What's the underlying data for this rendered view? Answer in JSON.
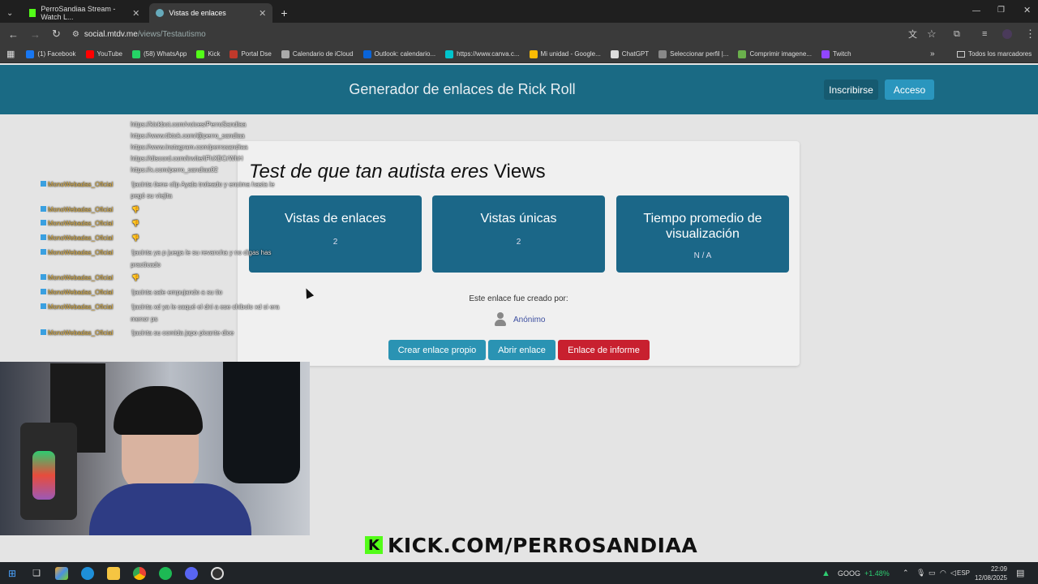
{
  "browser": {
    "tabs": [
      {
        "label": "PerroSandiaa Stream - Watch L..."
      },
      {
        "label": "Vistas de enlaces"
      }
    ],
    "url_host": "social.mtdv.me",
    "url_path": "/views/Testautismo",
    "bookmarks": [
      {
        "label": "(1) Facebook",
        "color": "#1877f2"
      },
      {
        "label": "YouTube",
        "color": "#ff0000"
      },
      {
        "label": "(58) WhatsApp",
        "color": "#25d366"
      },
      {
        "label": "Kick",
        "color": "#53fc18"
      },
      {
        "label": "Portal Dse",
        "color": "#c0392b"
      },
      {
        "label": "Calendario de iCloud",
        "color": "#aaaaaa"
      },
      {
        "label": "Outlook: calendario...",
        "color": "#0a64d8"
      },
      {
        "label": "https://www.canva.c...",
        "color": "#00c4cc"
      },
      {
        "label": "Mi unidad - Google...",
        "color": "#fbbc04"
      },
      {
        "label": "ChatGPT",
        "color": "#dddddd"
      },
      {
        "label": "Seleccionar perfil |...",
        "color": "#888888"
      },
      {
        "label": "Comprimir imagene...",
        "color": "#6ab04c"
      },
      {
        "label": "Twitch",
        "color": "#9146ff"
      }
    ],
    "all_bookmarks": "Todos los marcadores"
  },
  "site": {
    "title": "Generador de enlaces de Rick Roll",
    "signup": "Inscribirse",
    "login": "Acceso"
  },
  "card": {
    "title_italic": "Test de que tan autista eres",
    "title_suffix": " Views",
    "stats": [
      {
        "label": "Vistas de enlaces",
        "value": "2"
      },
      {
        "label": "Vistas únicas",
        "value": "2"
      },
      {
        "label": "Tiempo promedio de visualización",
        "value": "N / A"
      }
    ],
    "creator_label": "Este enlace fue creado por:",
    "creator_name": "Anónimo",
    "buttons": {
      "create": "Crear enlace propio",
      "open": "Abrir enlace",
      "report": "Enlace de informe"
    }
  },
  "chat": [
    {
      "user": "",
      "text": "https://kickbot.com/voices/PerroSandiaa"
    },
    {
      "user": "",
      "text": "https://www.tiktok.com/@perro_sandiaa"
    },
    {
      "user": "",
      "text": "https://www.instagram.com/perrosandiaa"
    },
    {
      "user": "",
      "text": "https://discord.com/invite/tFhXBCrWhH"
    },
    {
      "user": "",
      "text": "https://x.com/perro_sandiaa02"
    },
    {
      "user": "MonoWebadas_Oficial",
      "text": "!jacinta tiene clip Ayala troleado y encima hasta le"
    },
    {
      "user": "",
      "text": "pegó su viejita"
    },
    {
      "user": "MonoWebadas_Oficial",
      "text": "👎"
    },
    {
      "user": "MonoWebadas_Oficial",
      "text": "👎"
    },
    {
      "user": "MonoWebadas_Oficial",
      "text": "👎"
    },
    {
      "user": "MonoWebadas_Oficial",
      "text": "!jacinta ya p juega le su revancha y no digas has"
    },
    {
      "user": "",
      "text": "practicado"
    },
    {
      "user": "MonoWebadas_Oficial",
      "text": "👎"
    },
    {
      "user": "MonoWebadas_Oficial",
      "text": "!jacinta sale empujando a su tio"
    },
    {
      "user": "MonoWebadas_Oficial",
      "text": "!jacinta xd ya le saqué el dni a ese chibolo xd si era"
    },
    {
      "user": "",
      "text": "menor ps"
    },
    {
      "user": "MonoWebadas_Oficial",
      "text": "!jacinta su comida japo picante dice"
    }
  ],
  "overlay": {
    "kick_letter": "K",
    "kick_text": "KICK.COM/PERROSANDIAA"
  },
  "taskbar": {
    "stock_symbol": "GOOG",
    "stock_change": "+1.48%",
    "lang": "ESP",
    "time": "22:09",
    "date": "12/08/2025"
  }
}
